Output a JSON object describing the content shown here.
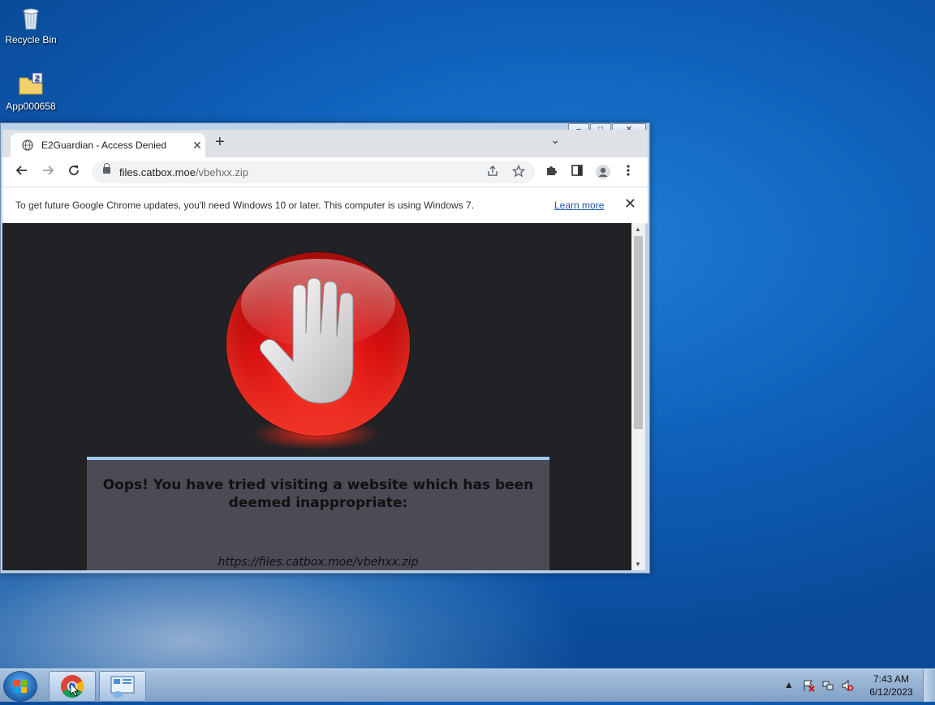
{
  "desktop": {
    "icons": [
      {
        "label": "Recycle Bin",
        "icon": "recycle-bin-icon"
      },
      {
        "label": "App000658",
        "icon": "folder-zip-icon"
      }
    ]
  },
  "window": {
    "caption_buttons": {
      "minimize": "‒",
      "restore": "□",
      "close": "✕"
    },
    "tab": {
      "title": "E2Guardian - Access Denied",
      "close": "✕"
    },
    "new_tab": "+",
    "tab_search": "⌄",
    "toolbar": {
      "url_host": "files.catbox.moe",
      "url_path": "/vbehxx.zip"
    },
    "infobar": {
      "message": "To get future Google Chrome updates, you'll need Windows 10 or later. This computer is using Windows 7.",
      "link": "Learn more",
      "close": "✕"
    },
    "page": {
      "heading": "Oops! You have tried visiting a website which has been deemed inappropriate:",
      "blocked_url": "https://files.catbox.moe/vbehxx.zip"
    }
  },
  "taskbar": {
    "clock_time": "7:43 AM",
    "clock_date": "6/12/2023"
  },
  "colors": {
    "desktop_blue": "#0e5fb8",
    "page_bg": "#202226",
    "panel_bg": "#4a4b55",
    "panel_accent": "#9cc7f0",
    "stop_red": "#d40e0e",
    "link_blue": "#1a56b8"
  }
}
